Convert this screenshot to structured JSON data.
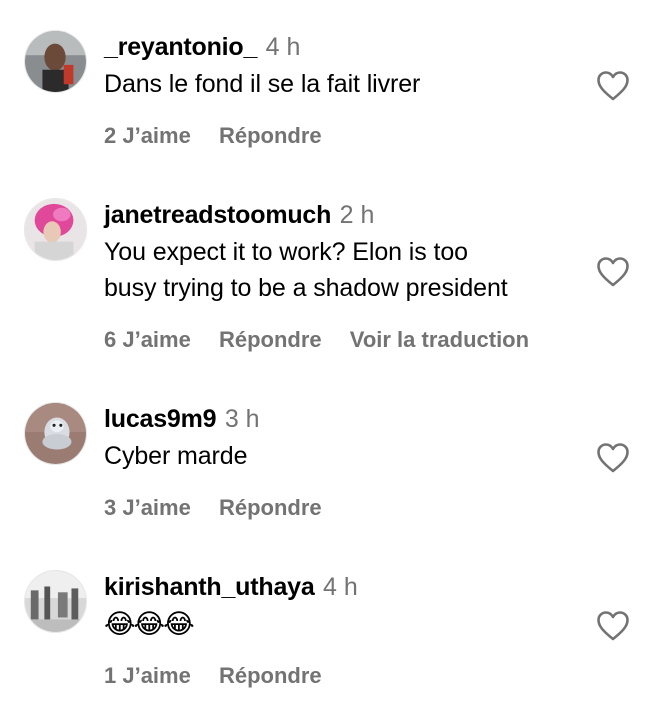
{
  "comments": [
    {
      "username": "_reyantonio_",
      "time": "4 h",
      "text": "Dans le fond il se la fait livrer",
      "likes": "2 J’aime",
      "reply": "Répondre",
      "translate": ""
    },
    {
      "username": "janetreadstoomuch",
      "time": "2 h",
      "text_line1": "You expect it to work? Elon is too",
      "text_line2": "busy trying to be a shadow president",
      "likes": "6 J’aime",
      "reply": "Répondre",
      "translate": "Voir la traduction"
    },
    {
      "username": "lucas9m9",
      "time": "3 h",
      "text": "Cyber marde",
      "likes": "3 J’aime",
      "reply": "Répondre"
    },
    {
      "username": "kirishanth_uthaya",
      "time": "4 h",
      "text": "😂😂😂",
      "likes": "1 J’aime",
      "reply": "Répondre"
    }
  ],
  "icons": {
    "like": "heart-outline-icon"
  },
  "colors": {
    "meta": "#737373",
    "text": "#000000"
  }
}
